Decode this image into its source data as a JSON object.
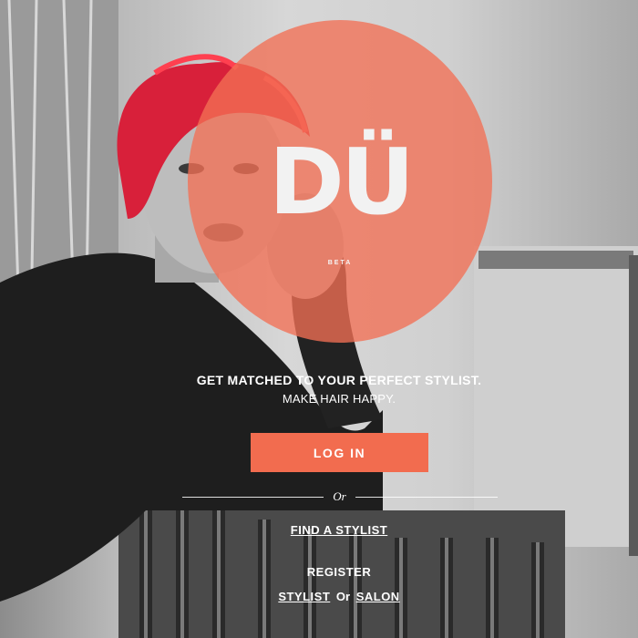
{
  "brand": {
    "logo_text": "DÜ",
    "badge": "BETA",
    "accent_color": "#f26c4f"
  },
  "hero": {
    "tagline": "GET MATCHED TO YOUR PERFECT STYLIST.",
    "subtagline": "MAKE HAIR HAPPY."
  },
  "actions": {
    "login_label": "LOG IN",
    "divider_text": "Or",
    "find_stylist_label": "FIND A STYLIST",
    "register_heading": "REGISTER",
    "register_stylist_label": "STYLIST",
    "register_or": "Or",
    "register_salon_label": "SALON"
  }
}
